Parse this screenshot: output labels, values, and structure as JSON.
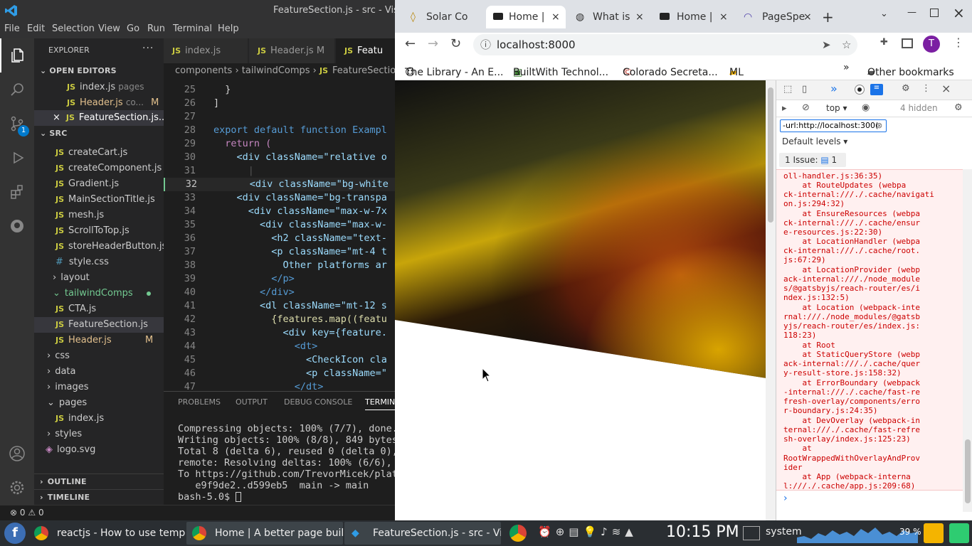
{
  "vscode": {
    "title": "FeatureSection.js - src - Visu",
    "menu": [
      "File",
      "Edit",
      "Selection",
      "View",
      "Go",
      "Run",
      "Terminal",
      "Help"
    ],
    "explorer_title": "EXPLORER",
    "open_editors_label": "OPEN EDITORS",
    "open_editors": [
      {
        "name": "index.js",
        "detail": "pages"
      },
      {
        "name": "Header.js",
        "detail": "co...",
        "badge": "M"
      },
      {
        "name": "FeatureSection.js...",
        "detail": ""
      }
    ],
    "src_label": "SRC",
    "files": [
      {
        "name": "createCart.js"
      },
      {
        "name": "createComponent.js"
      },
      {
        "name": "Gradient.js"
      },
      {
        "name": "MainSectionTitle.js"
      },
      {
        "name": "mesh.js"
      },
      {
        "name": "ScrollToTop.js"
      },
      {
        "name": "storeHeaderButton.js"
      },
      {
        "name": "style.css"
      },
      {
        "name": "layout"
      },
      {
        "name": "tailwindComps"
      },
      {
        "name": "CTA.js"
      },
      {
        "name": "FeatureSection.js"
      },
      {
        "name": "Header.js",
        "badge": "M"
      },
      {
        "name": "css"
      },
      {
        "name": "data"
      },
      {
        "name": "images"
      },
      {
        "name": "pages"
      },
      {
        "name": "index.js"
      },
      {
        "name": "styles"
      },
      {
        "name": "logo.svg"
      }
    ],
    "outline_label": "OUTLINE",
    "timeline_label": "TIMELINE",
    "tabs": [
      {
        "label": "index.js"
      },
      {
        "label": "Header.js",
        "badge": "M"
      },
      {
        "label": "Featu"
      }
    ],
    "breadcrumb": [
      "components",
      "tailwindComps",
      "FeatureSectio"
    ],
    "code_lines": [
      {
        "n": "25",
        "t": "  }"
      },
      {
        "n": "26",
        "t": "]"
      },
      {
        "n": "27",
        "t": ""
      },
      {
        "n": "28",
        "t": "export default function Exampl"
      },
      {
        "n": "29",
        "t": "  return ("
      },
      {
        "n": "30",
        "t": "    <div className=\"relative o"
      },
      {
        "n": "31",
        "t": "      |"
      },
      {
        "n": "32",
        "t": "      <div className=\"bg-white"
      },
      {
        "n": "33",
        "t": "    <div className=\"bg-transpa"
      },
      {
        "n": "34",
        "t": "      <div className=\"max-w-7x"
      },
      {
        "n": "35",
        "t": "        <div className=\"max-w-"
      },
      {
        "n": "36",
        "t": "          <h2 className=\"text-"
      },
      {
        "n": "37",
        "t": "          <p className=\"mt-4 t"
      },
      {
        "n": "38",
        "t": "            Other platforms ar"
      },
      {
        "n": "39",
        "t": "          </p>"
      },
      {
        "n": "40",
        "t": "        </div>"
      },
      {
        "n": "41",
        "t": "        <dl className=\"mt-12 s"
      },
      {
        "n": "42",
        "t": "          {features.map((featu"
      },
      {
        "n": "43",
        "t": "            <div key={feature."
      },
      {
        "n": "44",
        "t": "              <dt>"
      },
      {
        "n": "45",
        "t": "                <CheckIcon cla"
      },
      {
        "n": "46",
        "t": "                <p className=\""
      },
      {
        "n": "47",
        "t": "              </dt>"
      }
    ],
    "panel_tabs": [
      "PROBLEMS",
      "OUTPUT",
      "DEBUG CONSOLE",
      "TERMIN"
    ],
    "terminal_lines": [
      "Compressing objects: 100% (7/7), done.",
      "Writing objects: 100% (8/8), 849 bytes",
      "Total 8 (delta 6), reused 0 (delta 0),",
      "remote: Resolving deltas: 100% (6/6),",
      "To https://github.com/TrevorMicek/plat",
      "   e9f9de2..d599eb5  main -> main",
      "bash-5.0$ "
    ],
    "status_errors": "0",
    "status_warnings": "0",
    "scm_badge": "1"
  },
  "chrome": {
    "tabs": [
      {
        "label": "Solar Co"
      },
      {
        "label": "Home |",
        "active": true
      },
      {
        "label": "What is"
      },
      {
        "label": "Home |"
      },
      {
        "label": "PageSpe"
      }
    ],
    "url": "localhost:8000",
    "profile_initial": "T",
    "bookmarks": [
      "The Library - An E...",
      "BuiltWith Technol...",
      "Colorado Secreta...",
      "ML"
    ],
    "other_bookmarks": "Other bookmarks",
    "devtools": {
      "context": "top",
      "hidden_count": "4 hidden",
      "filter": "-url:http://localhost:300(",
      "levels": "Default levels",
      "issues_label": "1 Issue:",
      "issues_count": "1",
      "stack": [
        "oll-handler.js:36:35)",
        "    at RouteUpdates (webpa",
        "ck-internal:///./.cache/navigati",
        "on.js:294:32)",
        "    at EnsureResources (webpa",
        "ck-internal:///./.cache/ensur",
        "e-resources.js:22:30)",
        "    at LocationHandler (webpa",
        "ck-internal:///./.cache/root.",
        "js:67:29)",
        "    at LocationProvider (webp",
        "ack-internal:///./node_module",
        "s/@gatsbyjs/reach-router/es/i",
        "ndex.js:132:5)",
        "    at Location (webpack-inte",
        "rnal:///./node_modules/@gatsb",
        "yjs/reach-router/es/index.js:",
        "118:23)",
        "    at Root",
        "    at StaticQueryStore (webp",
        "ack-internal:///./.cache/quer",
        "y-result-store.js:158:32)",
        "    at ErrorBoundary (webpack",
        "-internal:///./.cache/fast-re",
        "fresh-overlay/components/erro",
        "r-boundary.js:24:35)",
        "    at DevOverlay (webpack-in",
        "ternal:///./.cache/fast-refre",
        "sh-overlay/index.js:125:23)",
        "    at",
        "RootWrappedWithOverlayAndProv",
        "ider",
        "    at App (webpack-interna",
        "l:///./.cache/app.js:209:68)"
      ]
    }
  },
  "taskbar": {
    "items": [
      {
        "label": "reactjs - How to use templat..."
      },
      {
        "label": "Home | A better page build..."
      },
      {
        "label": "FeatureSection.js - src - Visu..."
      }
    ],
    "clock": "10:15 PM",
    "system_label": "system",
    "cpu": "39 %"
  },
  "colors": {
    "vscode_bg": "#1e1e1e",
    "accent": "#007acc",
    "error_text": "#cc0000",
    "error_bg": "#fff0f0"
  }
}
